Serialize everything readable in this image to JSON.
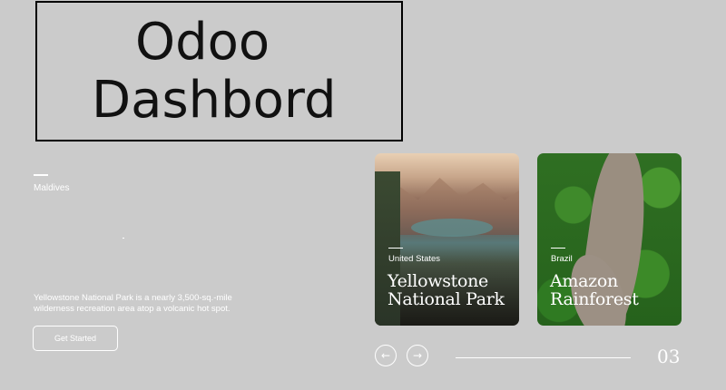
{
  "header": {
    "title_line1": "Odoo",
    "title_line2": "Dashbord"
  },
  "hero": {
    "location": "Maldives",
    "description": "Yellowstone National Park is a nearly 3,500-sq.-mile wilderness recreation area atop a volcanic hot spot.",
    "cta_label": "Get Started"
  },
  "cards": [
    {
      "country": "United States",
      "title": "Yellowstone National Park"
    },
    {
      "country": "Brazil",
      "title": "Amazon Rainforest"
    }
  ],
  "slider": {
    "prev_icon": "arrow-left-icon",
    "next_icon": "arrow-right-icon",
    "prev_glyph": "←",
    "next_glyph": "→",
    "page_number": "03"
  },
  "colors": {
    "background": "#cbcbcb",
    "text": "#ffffff",
    "title_border": "#000000"
  }
}
